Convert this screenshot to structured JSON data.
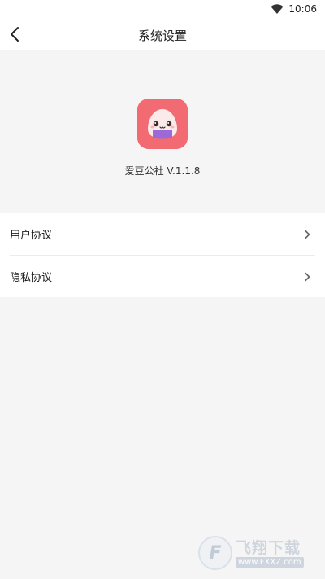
{
  "status_bar": {
    "time": "10:06",
    "wifi_icon": "wifi-icon"
  },
  "header": {
    "title": "系统设置",
    "back_icon": "chevron-left-icon"
  },
  "app": {
    "version_text": "爱豆公社 V.1.1.8",
    "icon": "app-logo-icon",
    "icon_color": "#f26b73"
  },
  "menu": {
    "items": [
      {
        "label": "用户协议",
        "icon": "chevron-right-icon"
      },
      {
        "label": "隐私协议",
        "icon": "chevron-right-icon"
      }
    ]
  },
  "watermark": {
    "title": "飞翔下载",
    "url": "www.FXXZ.com"
  },
  "colors": {
    "background": "#f5f5f5",
    "surface": "#ffffff",
    "brand": "#f26b73"
  }
}
